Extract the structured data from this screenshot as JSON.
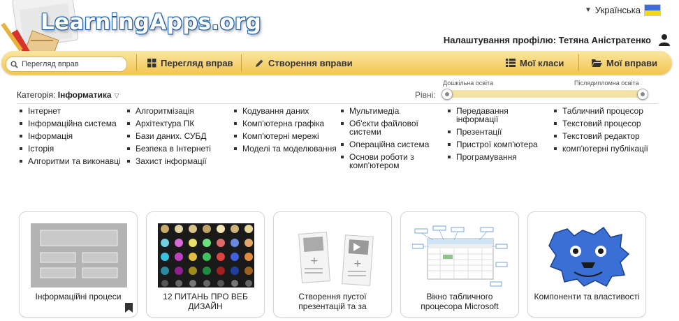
{
  "header": {
    "logo_text": "LearningApps.org",
    "language": "Українська",
    "profile": "Налаштування профілю: Тетяна Аністратенко"
  },
  "toolbar": {
    "search_placeholder": "Перегляд вправ",
    "browse_label": "Перегляд вправ",
    "create_label": "Створення вправи",
    "classes_label": "Мої класи",
    "apps_label": "Мої вправи"
  },
  "filters": {
    "category_prefix": "Категорія:",
    "category_value": "Інформатика",
    "levels_label": "Рівні:",
    "level_min_label": "Дошкільна освіта",
    "level_max_label": "Післядипломна освіта"
  },
  "subjects": {
    "col1": [
      "Інтернет",
      "Інформаційна система",
      "Інформація",
      "Історія",
      "Алгоритми та виконавці"
    ],
    "col2": [
      "Алгоритмізація",
      "Архітектура ПК",
      "Бази даних. СУБД",
      "Безпека в Інтернеті",
      "Захист інформації"
    ],
    "col3": [
      "Кодування даних",
      "Комп'ютерна графіка",
      "Комп'ютерні мережі",
      "Моделі та моделювання"
    ],
    "col4": [
      "Мультимедіа",
      "Об'єкти файлової системи",
      "Операційна система",
      "Основи роботи з комп'ютером"
    ],
    "col5": [
      "Передавання інформації",
      "Презентації",
      "Пристрої комп'ютера",
      "Програмування"
    ],
    "col6": [
      "Табличний процесор",
      "Текстовий процесор",
      "Текстовий редактор",
      "комп'ютерні публікації"
    ]
  },
  "cards": [
    {
      "title": "Інформаційні процеси"
    },
    {
      "title": "12 ПИТАНЬ ПРО ВЕБ ДИЗАЙН"
    },
    {
      "title": "Створення пустої презентацій та за"
    },
    {
      "title": "Вікно табличного процесора Microsoft"
    },
    {
      "title": "Компоненти та властивості"
    }
  ],
  "colors": {
    "toolbar_top": "#fbe6a0",
    "toolbar_bottom": "#f3c552",
    "logo_outline": "#1b5fa6"
  }
}
